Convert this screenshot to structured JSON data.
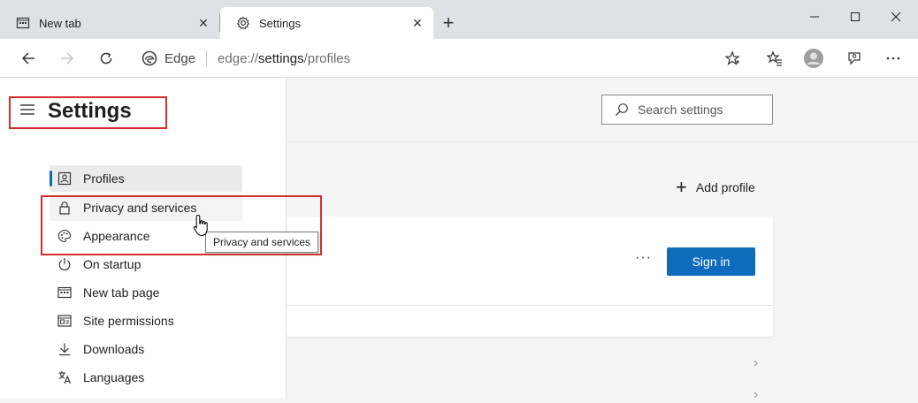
{
  "tabs": [
    {
      "title": "New tab",
      "icon": "newtab-page-icon"
    },
    {
      "title": "Settings",
      "icon": "gear-icon"
    }
  ],
  "address_bar": {
    "site_name": "Edge",
    "url_scheme": "edge://",
    "url_host": "settings",
    "url_path": "/profiles"
  },
  "sidebar": {
    "title": "Settings",
    "items": [
      {
        "label": "Profiles",
        "icon": "profile-icon",
        "state": "selected"
      },
      {
        "label": "Privacy and services",
        "icon": "lock-icon",
        "state": "hover"
      },
      {
        "label": "Appearance",
        "icon": "palette-icon"
      },
      {
        "label": "On startup",
        "icon": "power-icon"
      },
      {
        "label": "New tab page",
        "icon": "newtab-page-icon"
      },
      {
        "label": "Site permissions",
        "icon": "site-permissions-icon"
      },
      {
        "label": "Downloads",
        "icon": "download-icon"
      },
      {
        "label": "Languages",
        "icon": "languages-icon"
      }
    ]
  },
  "main": {
    "search_placeholder": "Search settings",
    "add_profile_label": "Add profile",
    "more_label": "···",
    "sign_in_label": "Sign in"
  },
  "tooltip": {
    "text": "Privacy and services"
  },
  "colors": {
    "accent": "#0f6cbd",
    "annotation_red": "#d32f2f",
    "tabstrip_bg": "#dee1e6"
  }
}
